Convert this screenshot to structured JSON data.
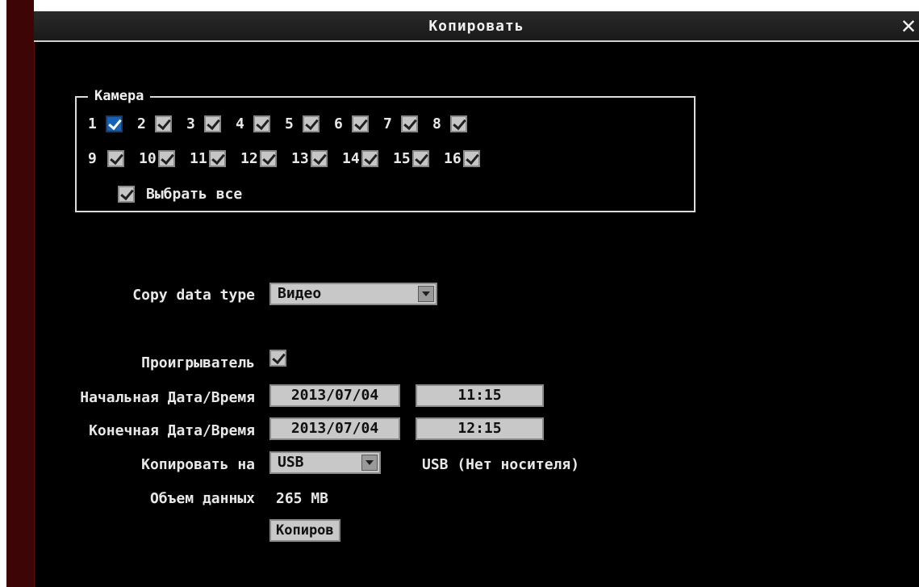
{
  "window": {
    "title": "Копировать"
  },
  "camera": {
    "legend": "Камера",
    "row1": [
      {
        "num": "1",
        "checked": true,
        "focused": true
      },
      {
        "num": "2",
        "checked": true
      },
      {
        "num": "3",
        "checked": true
      },
      {
        "num": "4",
        "checked": true
      },
      {
        "num": "5",
        "checked": true
      },
      {
        "num": "6",
        "checked": true
      },
      {
        "num": "7",
        "checked": true
      },
      {
        "num": "8",
        "checked": true
      }
    ],
    "row2": [
      {
        "num": "9",
        "checked": true
      },
      {
        "num": "10",
        "checked": true
      },
      {
        "num": "11",
        "checked": true
      },
      {
        "num": "12",
        "checked": true
      },
      {
        "num": "13",
        "checked": true
      },
      {
        "num": "14",
        "checked": true
      },
      {
        "num": "15",
        "checked": true
      },
      {
        "num": "16",
        "checked": true
      }
    ],
    "select_all_label": "Выбрать все"
  },
  "form": {
    "copy_type_label": "Copy data type",
    "copy_type_value": "Видео",
    "player_label": "Проигрыватель",
    "start_label": "Начальная Дата/Время",
    "start_date": "2013/07/04",
    "start_time": "11:15",
    "end_label": "Конечная Дата/Время",
    "end_date": "2013/07/04",
    "end_time": "12:15",
    "copy_to_label": "Копировать на",
    "copy_to_value": "USB",
    "copy_to_status": "USB (Нет носителя)",
    "data_size_label": "Объем данных",
    "data_size_value": "265 MB",
    "copy_button": "Копиров"
  },
  "colors": {
    "background": "#000000",
    "focus_blue": "#1463b6",
    "field_gray": "#c8c8c8",
    "left_strip": "#3d0505"
  },
  "icons": {
    "close": "close-icon",
    "dropdown": "chevron-down-icon",
    "check": "checkmark-icon"
  }
}
